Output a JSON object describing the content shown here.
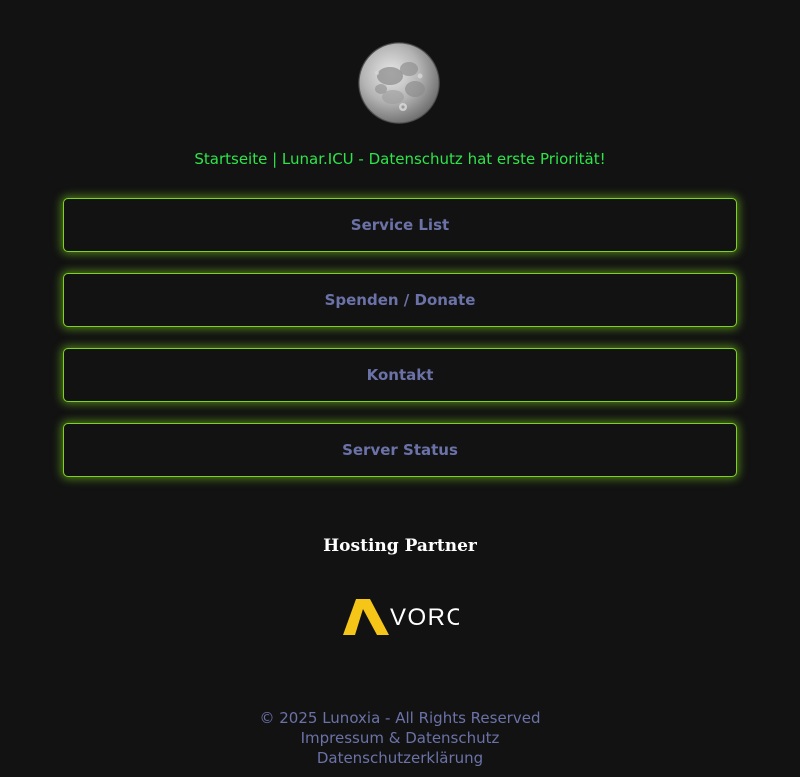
{
  "header": {
    "logo_icon": "moon-icon",
    "tagline": "Startseite | Lunar.ICU - Datenschutz hat erste Priorität!",
    "tagline_color": "#2ee44a"
  },
  "nav": {
    "buttons": [
      {
        "label": "Service List"
      },
      {
        "label": "Spenden / Donate"
      },
      {
        "label": "Kontakt"
      },
      {
        "label": "Server Status"
      }
    ],
    "border_color": "#7ed321",
    "text_color": "#6b72a8"
  },
  "partner": {
    "title": "Hosting Partner",
    "logo_text": "VORO",
    "logo_accent": "#f5c518"
  },
  "footer": {
    "copyright": "© 2025 Lunoxia - All Rights Reserved",
    "impressum": "Impressum & Datenschutz",
    "privacy": "Datenschutzerklärung"
  }
}
